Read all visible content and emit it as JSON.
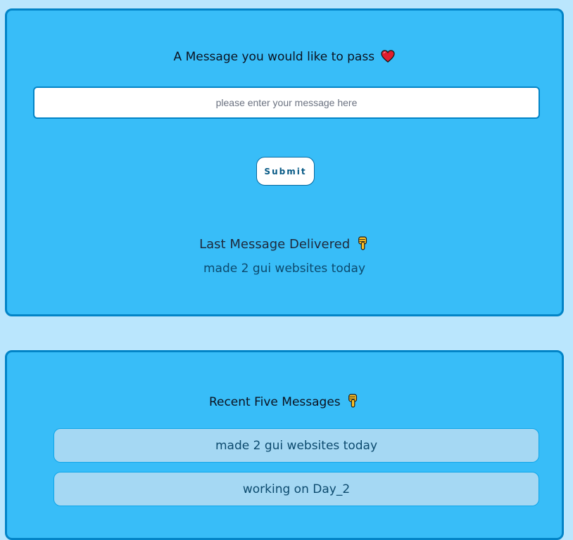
{
  "form": {
    "heading": "A Message you would like to pass",
    "heading_icon": "heart-icon",
    "input_placeholder": "please enter your message here",
    "input_value": "",
    "submit_label": "Submit"
  },
  "last": {
    "heading": "Last Message Delivered",
    "heading_icon": "pointing-down-icon",
    "message": "made 2 gui websites today"
  },
  "recent": {
    "heading": "Recent Five Messages",
    "heading_icon": "pointing-down-icon",
    "items": [
      {
        "text": "made 2 gui websites today"
      },
      {
        "text": "working on Day_2"
      }
    ]
  },
  "colors": {
    "page_background": "#bae6fd",
    "card_background": "#38bdf8",
    "card_border": "#0284c7",
    "item_background": "#a5d8f3"
  }
}
